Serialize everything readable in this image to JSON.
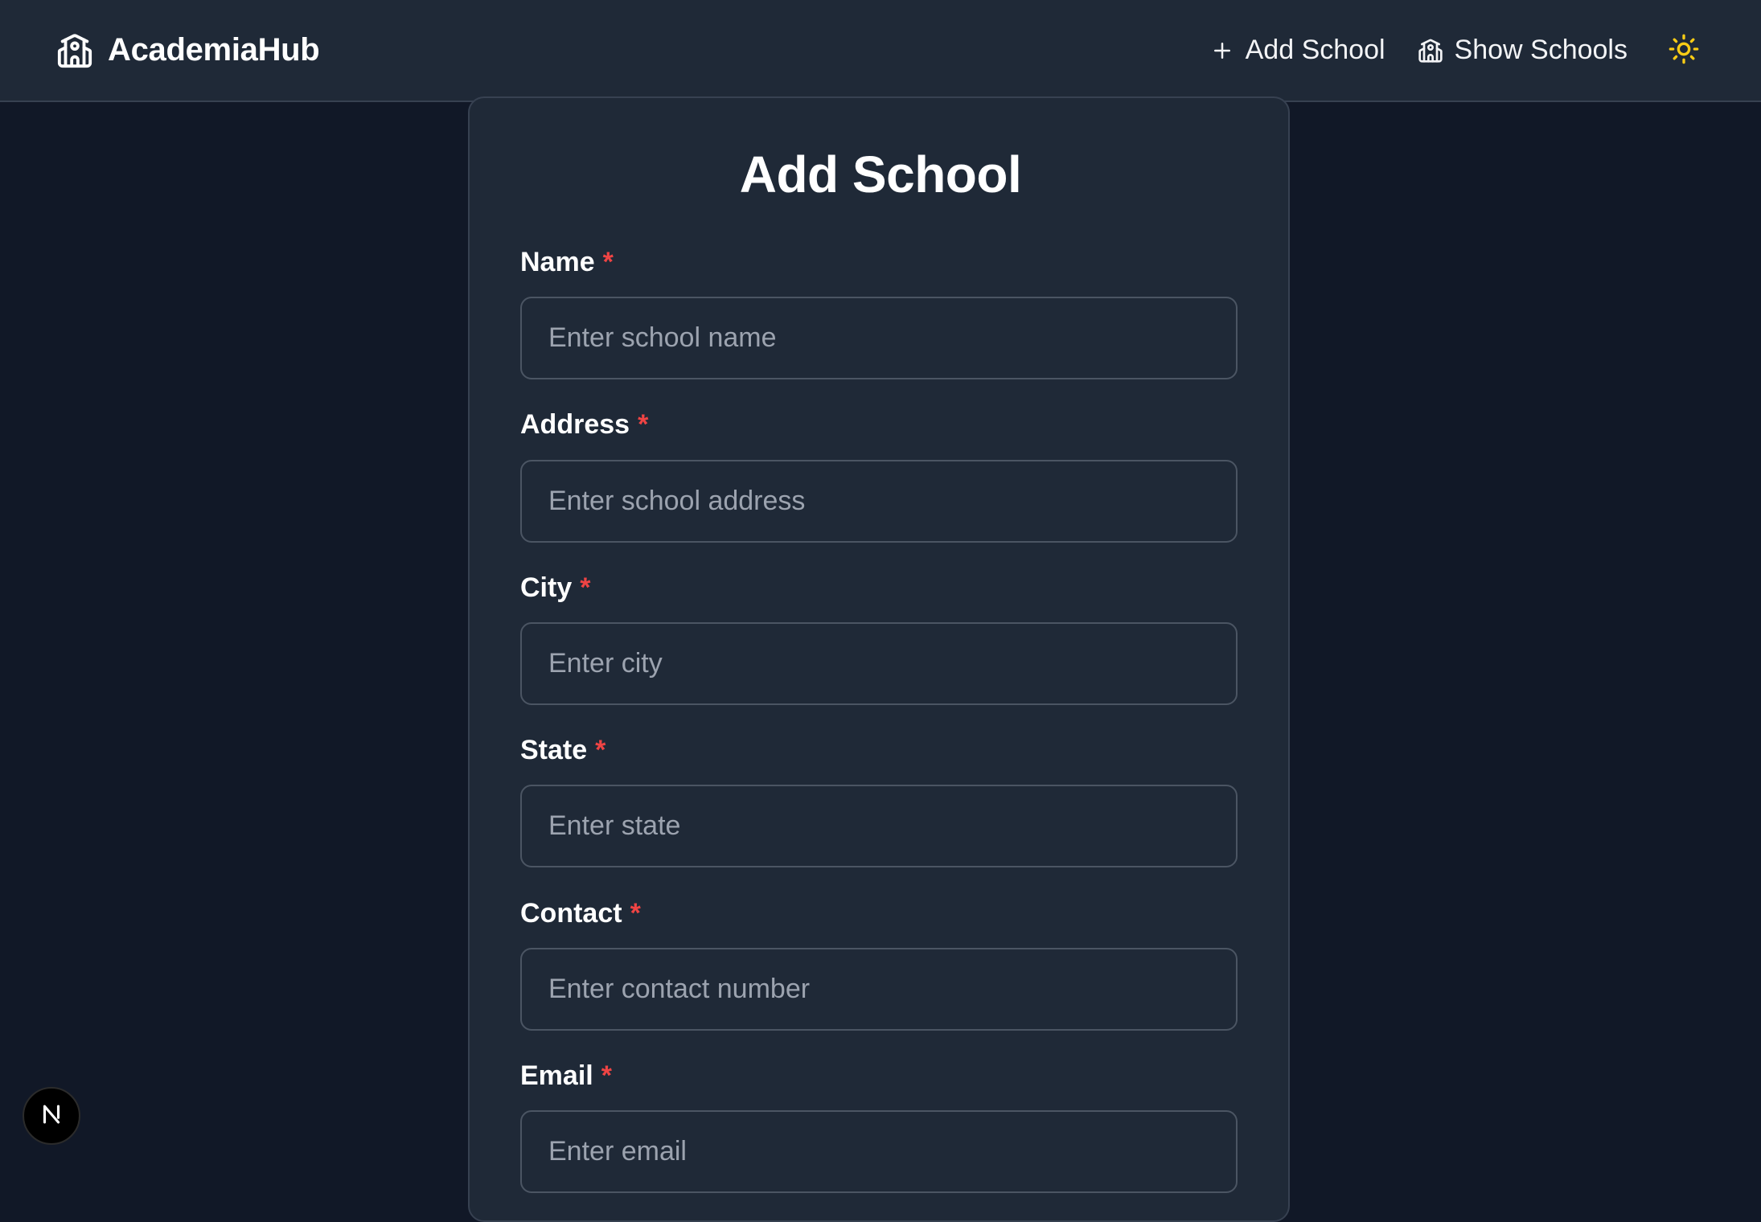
{
  "navbar": {
    "brand_name": "AcademiaHub",
    "brand_icon": "school-icon",
    "links": [
      {
        "label": "Add School",
        "icon": "plus-icon"
      },
      {
        "label": "Show Schools",
        "icon": "school-icon"
      }
    ],
    "theme_toggle_icon": "sun-icon"
  },
  "form": {
    "title": "Add School",
    "required_marker": "*",
    "fields": [
      {
        "label": "Name",
        "placeholder": "Enter school name",
        "value": ""
      },
      {
        "label": "Address",
        "placeholder": "Enter school address",
        "value": ""
      },
      {
        "label": "City",
        "placeholder": "Enter city",
        "value": ""
      },
      {
        "label": "State",
        "placeholder": "Enter state",
        "value": ""
      },
      {
        "label": "Contact",
        "placeholder": "Enter contact number",
        "value": ""
      },
      {
        "label": "Email",
        "placeholder": "Enter email",
        "value": ""
      }
    ]
  },
  "badge": {
    "letter": "N"
  },
  "colors": {
    "background": "#111827",
    "surface": "#1f2937",
    "border": "#374151",
    "input_border": "#4b5563",
    "required": "#ef4444",
    "sun": "#facc15",
    "placeholder": "#9ca3af"
  }
}
